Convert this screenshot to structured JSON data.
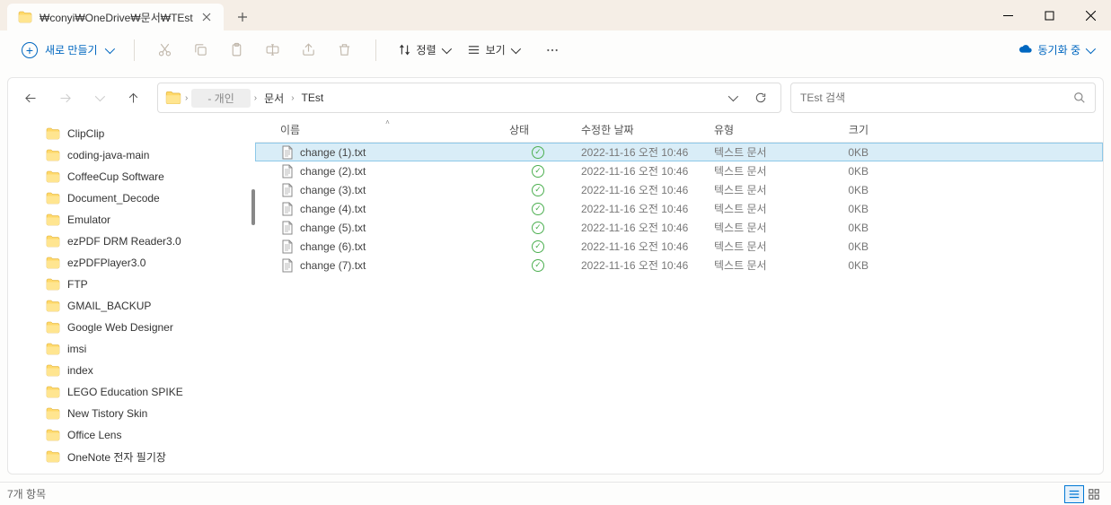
{
  "tab": {
    "title": "₩conyi₩OneDrive₩문서₩TEst"
  },
  "toolbar": {
    "new_label": "새로 만들기",
    "sort_label": "정렬",
    "view_label": "보기",
    "sync_label": "동기화 중"
  },
  "breadcrumb": {
    "root": "- 개인",
    "items": [
      "문서",
      "TEst"
    ]
  },
  "search": {
    "placeholder": "TEst 검색"
  },
  "columns": {
    "name": "이름",
    "status": "상태",
    "date": "수정한 날짜",
    "type": "유형",
    "size": "크기"
  },
  "sidebar": {
    "items": [
      "ClipClip",
      "coding-java-main",
      "CoffeeCup Software",
      "Document_Decode",
      "Emulator",
      "ezPDF DRM Reader3.0",
      "ezPDFPlayer3.0",
      "FTP",
      "GMAIL_BACKUP",
      "Google Web Designer",
      "imsi",
      "index",
      "LEGO Education SPIKE",
      "New Tistory Skin",
      "Office Lens",
      "OneNote 전자 필기장"
    ]
  },
  "files": [
    {
      "name": "change (1).txt",
      "date": "2022-11-16 오전 10:46",
      "type": "텍스트 문서",
      "size": "0KB",
      "selected": true
    },
    {
      "name": "change (2).txt",
      "date": "2022-11-16 오전 10:46",
      "type": "텍스트 문서",
      "size": "0KB",
      "selected": false
    },
    {
      "name": "change (3).txt",
      "date": "2022-11-16 오전 10:46",
      "type": "텍스트 문서",
      "size": "0KB",
      "selected": false
    },
    {
      "name": "change (4).txt",
      "date": "2022-11-16 오전 10:46",
      "type": "텍스트 문서",
      "size": "0KB",
      "selected": false
    },
    {
      "name": "change (5).txt",
      "date": "2022-11-16 오전 10:46",
      "type": "텍스트 문서",
      "size": "0KB",
      "selected": false
    },
    {
      "name": "change (6).txt",
      "date": "2022-11-16 오전 10:46",
      "type": "텍스트 문서",
      "size": "0KB",
      "selected": false
    },
    {
      "name": "change (7).txt",
      "date": "2022-11-16 오전 10:46",
      "type": "텍스트 문서",
      "size": "0KB",
      "selected": false
    }
  ],
  "status": {
    "count": "7개 항목"
  }
}
